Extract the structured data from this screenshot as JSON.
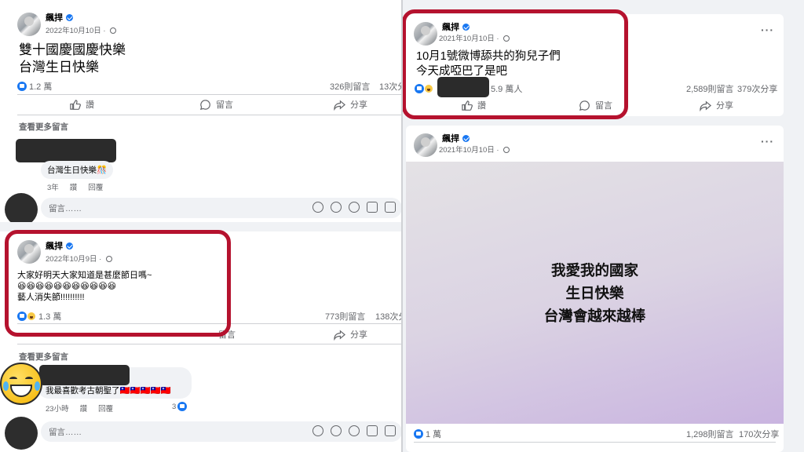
{
  "post1": {
    "author": "飆捍",
    "date": "2022年10月10日 · ",
    "line1": "雙十國慶國慶快樂",
    "line2": "台灣生日快樂",
    "reactions": "1.2 萬",
    "comments": "326則留言",
    "shares": "13次分",
    "more_comments": "查看更多留言",
    "comment_text": "台灣生日快樂🎊",
    "comment_age": "3年",
    "comment_like": "讚",
    "comment_reply": "回覆",
    "comment_placeholder": "留言……"
  },
  "post2": {
    "author": "飆捍",
    "date": "2022年10月9日 · ",
    "line1": "大家好明天大家知道是甚麼節日嗎~",
    "line2": "😆😆😆😆😆😆😆😆😆😆😆",
    "line3": "藝人消失節!!!!!!!!!!",
    "reactions": "1.3 萬",
    "comments": "773則留言",
    "shares": "138次分",
    "more_comments": "查看更多留言",
    "comment_text": "我最喜歡考古朝聖了🇹🇼🇹🇼🇹🇼🇹🇼🇹🇼",
    "comment_age": "23小時",
    "comment_like": "讚",
    "comment_reply": "回覆",
    "comment_likes": "3",
    "comment_placeholder": "留言……"
  },
  "post3": {
    "author": "飆捍",
    "date": "2021年10月10日 · ",
    "line1": "10月1號微博舔共的狗兒子們",
    "line2": "今天成啞巴了是吧",
    "reactions": "5.9 萬人",
    "comments": "2,589則留言",
    "shares": "379次分享",
    "menu": "···"
  },
  "post4": {
    "author": "飆捍",
    "date": "2021年10月10日 · ",
    "image_line1": "我愛我的國家",
    "image_line2": "生日快樂",
    "image_line3": "台灣會越來越棒",
    "reactions": "1 萬",
    "comments": "1,298則留言",
    "shares": "170次分享",
    "menu": "···"
  },
  "actions": {
    "like": "讚",
    "comment": "留言",
    "share": "分享"
  },
  "colors": {
    "highlight": "#b5122e",
    "facebook_blue": "#1877f2",
    "card_gradient_top": "#e4e2e5",
    "card_gradient_bottom": "#c9b4e0"
  },
  "icons": [
    "verified-badge-icon",
    "globe-icon",
    "like-icon",
    "comment-icon",
    "share-icon",
    "sticker-icon",
    "emoji-icon",
    "camera-icon",
    "gif-icon",
    "more-options-icon",
    "laughing-emoji-icon"
  ]
}
